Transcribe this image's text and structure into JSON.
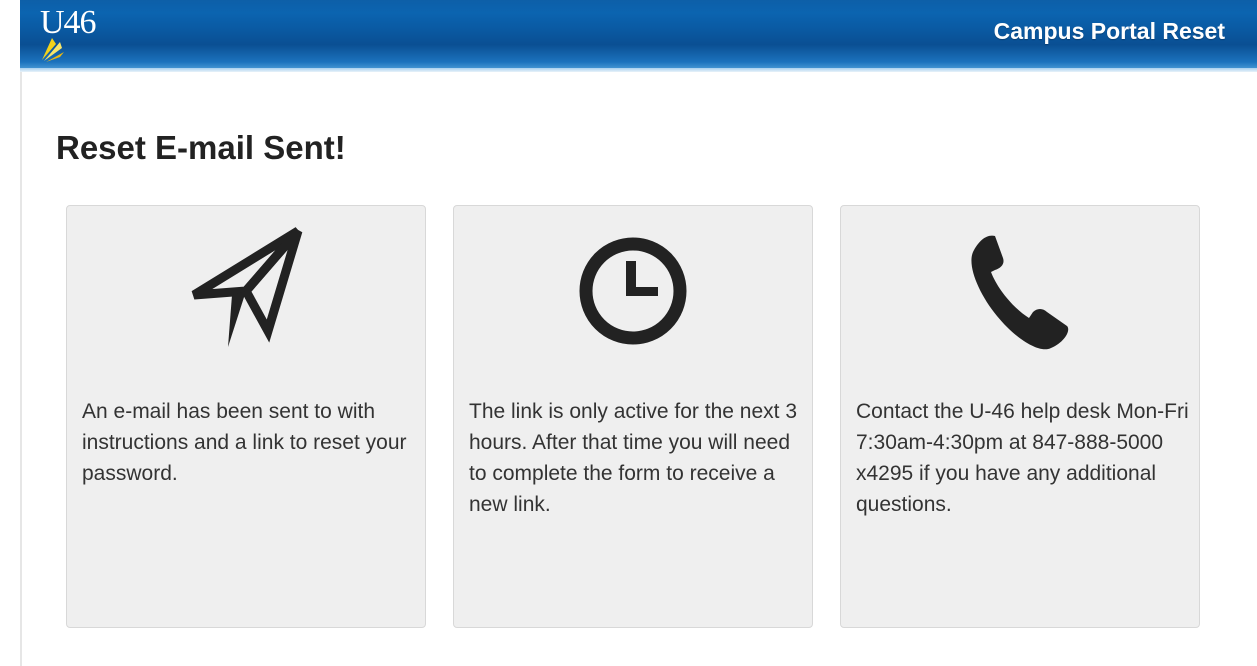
{
  "header": {
    "logo_text": "U46",
    "title": "Campus Portal Reset"
  },
  "main": {
    "heading": "Reset E-mail Sent!",
    "cards": [
      {
        "icon": "paper-plane-icon",
        "text": "An e-mail has been sent to with instructions and a link to reset your password."
      },
      {
        "icon": "clock-icon",
        "text": "The link is only active for the next 3 hours. After that time you will need to complete the form to receive a new link."
      },
      {
        "icon": "phone-icon",
        "text": "Contact the U-46 help desk Mon-Fri 7:30am-4:30pm at 847-888-5000 x4295 if you have any additional questions."
      }
    ]
  },
  "colors": {
    "header_blue": "#0a5aa3",
    "card_background": "#efefef",
    "icon_color": "#222222",
    "text_color": "#333333"
  }
}
